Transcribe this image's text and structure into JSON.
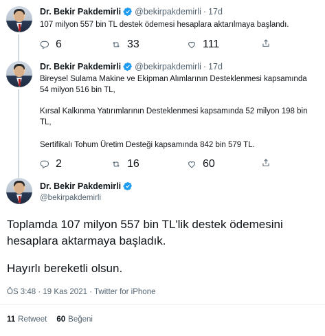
{
  "author": {
    "name": "Dr. Bekir Pakdemirli",
    "handle": "@bekirpakdemirli"
  },
  "tweets": [
    {
      "time": "17d",
      "text": "107 milyon 557 bin TL destek ödemesi hesaplara aktarılmaya başlandı.",
      "replies": "6",
      "retweets": "33",
      "likes": "111"
    },
    {
      "time": "17d",
      "lines": [
        "Bireysel Sulama Makine ve Ekipman Alımlarının Desteklenmesi kapsamında",
        "54 milyon 516 bin TL,",
        "Kırsal Kalkınma Yatırımlarının Desteklenmesi kapsamında 52 milyon 198 bin",
        "TL,",
        "Sertifikalı Tohum Üretim Desteği kapsamında 842 bin 579 TL."
      ],
      "replies": "2",
      "retweets": "16",
      "likes": "60"
    }
  ],
  "main_tweet": {
    "line1": "Toplamda 107 milyon 557 bin TL'lik destek ödemesini",
    "line2": "hesaplara aktarmaya başladık.",
    "line3": "Hayırlı bereketli olsun.",
    "meta": "ÖS 3:48 · 19 Kas 2021 · Twitter for iPhone",
    "retweet_count": "11",
    "retweet_label": "Retweet",
    "like_count": "60",
    "like_label": "Beğeni"
  },
  "colors": {
    "verified": "#1d9bf0",
    "secondary_text": "#536471",
    "divider": "#eff3f4"
  }
}
